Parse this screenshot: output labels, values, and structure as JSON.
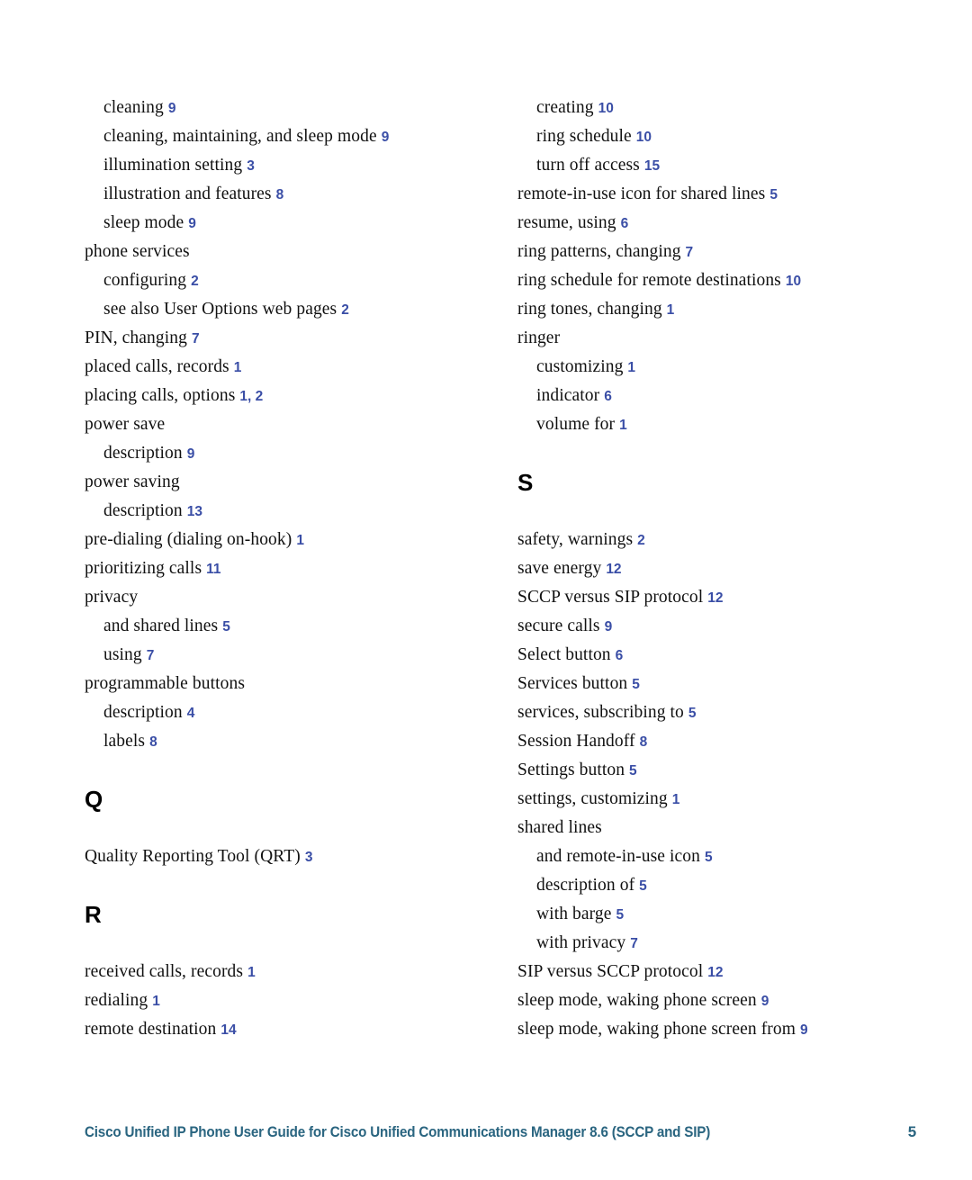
{
  "document": {
    "type": "index",
    "footer_text": "Cisco Unified IP Phone User Guide for Cisco Unified Communications Manager 8.6 (SCCP and SIP)",
    "footer_page": "5",
    "accent_page_number_color": "#3a4ea6",
    "footer_color": "#2a6580"
  },
  "columns": {
    "left": [
      {
        "kind": "entry",
        "level": 1,
        "text": "cleaning",
        "pages": "9"
      },
      {
        "kind": "entry",
        "level": 1,
        "text": "cleaning, maintaining, and sleep mode",
        "pages": "9"
      },
      {
        "kind": "entry",
        "level": 1,
        "text": "illumination setting",
        "pages": "3"
      },
      {
        "kind": "entry",
        "level": 1,
        "text": "illustration and features",
        "pages": "8"
      },
      {
        "kind": "entry",
        "level": 1,
        "text": "sleep mode",
        "pages": "9"
      },
      {
        "kind": "entry",
        "level": 0,
        "text": "phone services",
        "pages": ""
      },
      {
        "kind": "entry",
        "level": 1,
        "text": "configuring",
        "pages": "2"
      },
      {
        "kind": "entry",
        "level": 1,
        "text": "see also User Options web pages",
        "pages": "2"
      },
      {
        "kind": "entry",
        "level": 0,
        "text": "PIN, changing",
        "pages": "7"
      },
      {
        "kind": "entry",
        "level": 0,
        "text": "placed calls, records",
        "pages": "1"
      },
      {
        "kind": "entry",
        "level": 0,
        "text": "placing calls, options",
        "pages": "1, 2"
      },
      {
        "kind": "entry",
        "level": 0,
        "text": "power save",
        "pages": ""
      },
      {
        "kind": "entry",
        "level": 1,
        "text": "description",
        "pages": "9"
      },
      {
        "kind": "entry",
        "level": 0,
        "text": "power saving",
        "pages": ""
      },
      {
        "kind": "entry",
        "level": 1,
        "text": "description",
        "pages": "13"
      },
      {
        "kind": "entry",
        "level": 0,
        "text": "pre-dialing (dialing on-hook)",
        "pages": "1"
      },
      {
        "kind": "entry",
        "level": 0,
        "text": "prioritizing calls",
        "pages": "11"
      },
      {
        "kind": "entry",
        "level": 0,
        "text": "privacy",
        "pages": ""
      },
      {
        "kind": "entry",
        "level": 1,
        "text": "and shared lines",
        "pages": "5"
      },
      {
        "kind": "entry",
        "level": 1,
        "text": "using",
        "pages": "7"
      },
      {
        "kind": "entry",
        "level": 0,
        "text": "programmable buttons",
        "pages": ""
      },
      {
        "kind": "entry",
        "level": 1,
        "text": "description",
        "pages": "4"
      },
      {
        "kind": "entry",
        "level": 1,
        "text": "labels",
        "pages": "8"
      },
      {
        "kind": "spacer"
      },
      {
        "kind": "letter",
        "text": "Q"
      },
      {
        "kind": "spacer"
      },
      {
        "kind": "entry",
        "level": 0,
        "text": "Quality Reporting Tool (QRT)",
        "pages": "3"
      },
      {
        "kind": "spacer"
      },
      {
        "kind": "letter",
        "text": "R"
      },
      {
        "kind": "spacer"
      },
      {
        "kind": "entry",
        "level": 0,
        "text": "received calls, records",
        "pages": "1"
      },
      {
        "kind": "entry",
        "level": 0,
        "text": "redialing",
        "pages": "1"
      },
      {
        "kind": "entry",
        "level": 0,
        "text": "remote destination",
        "pages": "14"
      }
    ],
    "right": [
      {
        "kind": "entry",
        "level": 1,
        "text": "creating",
        "pages": "10"
      },
      {
        "kind": "entry",
        "level": 1,
        "text": "ring schedule",
        "pages": "10"
      },
      {
        "kind": "entry",
        "level": 1,
        "text": "turn off access",
        "pages": "15"
      },
      {
        "kind": "entry",
        "level": 0,
        "text": "remote-in-use icon for shared lines",
        "pages": "5"
      },
      {
        "kind": "entry",
        "level": 0,
        "text": "resume, using",
        "pages": "6"
      },
      {
        "kind": "entry",
        "level": 0,
        "text": "ring patterns, changing",
        "pages": "7"
      },
      {
        "kind": "entry",
        "level": 0,
        "text": "ring schedule for remote destinations",
        "pages": "10"
      },
      {
        "kind": "entry",
        "level": 0,
        "text": "ring tones, changing",
        "pages": "1"
      },
      {
        "kind": "entry",
        "level": 0,
        "text": "ringer",
        "pages": ""
      },
      {
        "kind": "entry",
        "level": 1,
        "text": "customizing",
        "pages": "1"
      },
      {
        "kind": "entry",
        "level": 1,
        "text": "indicator",
        "pages": "6"
      },
      {
        "kind": "entry",
        "level": 1,
        "text": "volume for",
        "pages": "1"
      },
      {
        "kind": "spacer"
      },
      {
        "kind": "letter",
        "text": "S"
      },
      {
        "kind": "spacer"
      },
      {
        "kind": "entry",
        "level": 0,
        "text": "safety, warnings",
        "pages": "2"
      },
      {
        "kind": "entry",
        "level": 0,
        "text": "save energy",
        "pages": "12"
      },
      {
        "kind": "entry",
        "level": 0,
        "text": "SCCP versus SIP protocol",
        "pages": "12"
      },
      {
        "kind": "entry",
        "level": 0,
        "text": "secure calls",
        "pages": "9"
      },
      {
        "kind": "entry",
        "level": 0,
        "text": "Select button",
        "pages": "6"
      },
      {
        "kind": "entry",
        "level": 0,
        "text": "Services button",
        "pages": "5"
      },
      {
        "kind": "entry",
        "level": 0,
        "text": "services, subscribing to",
        "pages": "5"
      },
      {
        "kind": "entry",
        "level": 0,
        "text": "Session Handoff",
        "pages": "8"
      },
      {
        "kind": "entry",
        "level": 0,
        "text": "Settings button",
        "pages": "5"
      },
      {
        "kind": "entry",
        "level": 0,
        "text": "settings, customizing",
        "pages": "1"
      },
      {
        "kind": "entry",
        "level": 0,
        "text": "shared lines",
        "pages": ""
      },
      {
        "kind": "entry",
        "level": 1,
        "text": "and remote-in-use icon",
        "pages": "5"
      },
      {
        "kind": "entry",
        "level": 1,
        "text": "description of",
        "pages": "5"
      },
      {
        "kind": "entry",
        "level": 1,
        "text": "with barge",
        "pages": "5"
      },
      {
        "kind": "entry",
        "level": 1,
        "text": "with privacy",
        "pages": "7"
      },
      {
        "kind": "entry",
        "level": 0,
        "text": "SIP versus SCCP protocol",
        "pages": "12"
      },
      {
        "kind": "entry",
        "level": 0,
        "text": "sleep mode, waking phone screen",
        "pages": "9"
      },
      {
        "kind": "entry",
        "level": 0,
        "text": "sleep mode, waking phone screen from",
        "pages": "9"
      }
    ]
  }
}
